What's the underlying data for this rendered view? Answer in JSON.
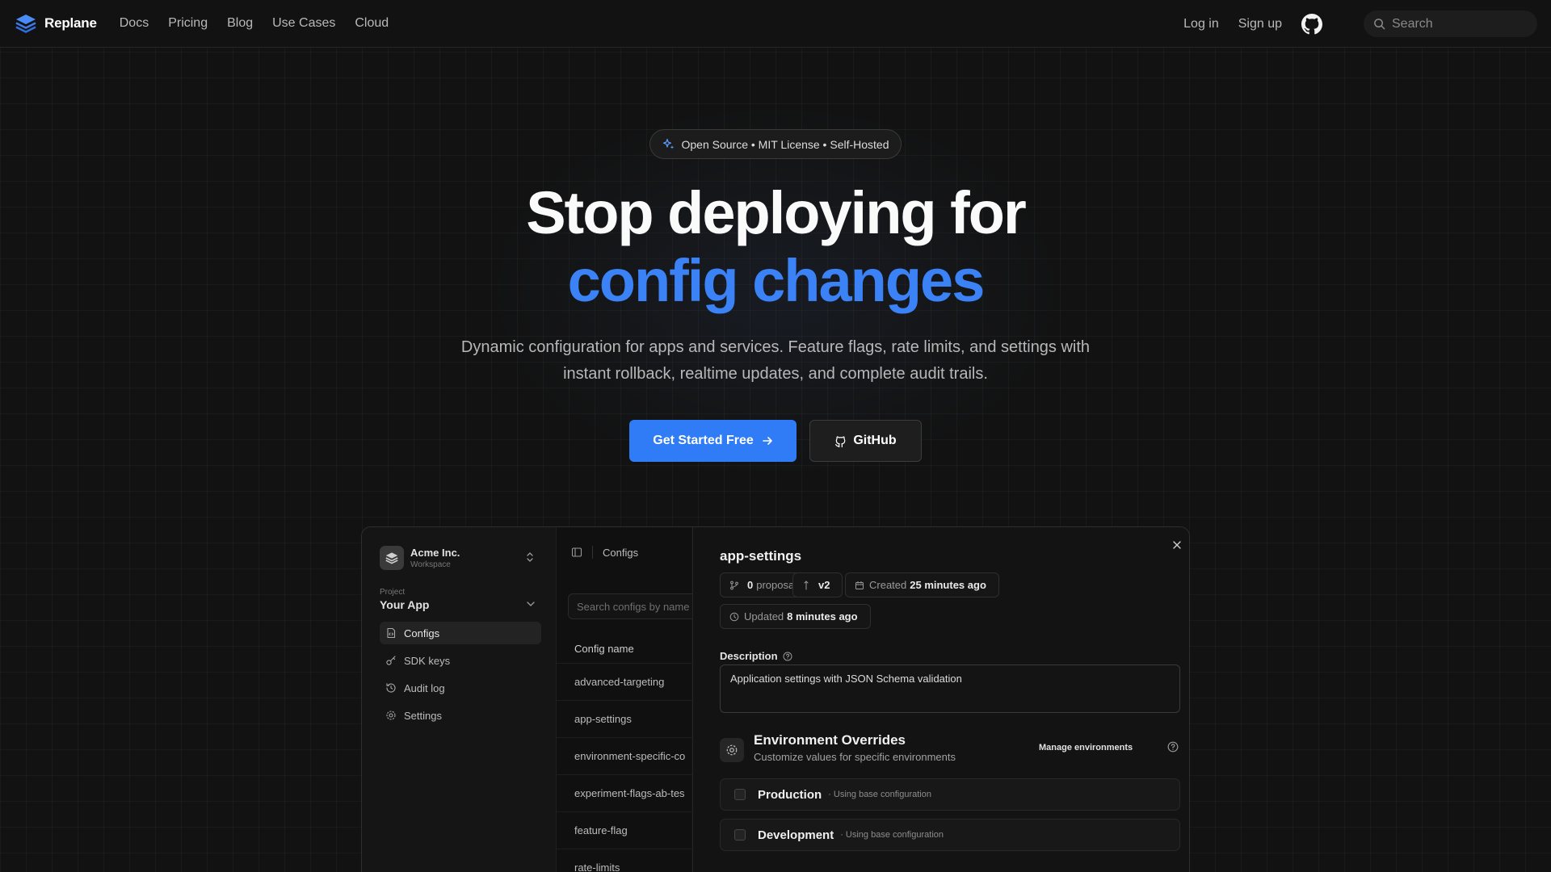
{
  "nav": {
    "brand": "Replane",
    "links": [
      "Docs",
      "Pricing",
      "Blog",
      "Use Cases",
      "Cloud"
    ],
    "login": "Log in",
    "signup": "Sign up",
    "search_placeholder": "Search"
  },
  "hero": {
    "badge": "Open Source • MIT License • Self-Hosted",
    "title_line1": "Stop deploying for",
    "title_line2": "config changes",
    "subtitle": "Dynamic configuration for apps and services. Feature flags, rate limits, and settings with instant rollback, realtime updates, and complete audit trails.",
    "cta_primary": "Get Started Free",
    "cta_secondary": "GitHub"
  },
  "preview": {
    "workspace_name": "Acme Inc.",
    "workspace_label": "Workspace",
    "project_label": "Project",
    "project_name": "Your App",
    "sidebar_items": [
      "Configs",
      "SDK keys",
      "Audit log",
      "Settings"
    ],
    "list_title": "Configs",
    "list_search_placeholder": "Search configs by name",
    "list_header": "Config name",
    "configs": [
      "advanced-targeting",
      "app-settings",
      "environment-specific-co",
      "experiment-flags-ab-tes",
      "feature-flag",
      "rate-limits"
    ],
    "detail": {
      "title": "app-settings",
      "proposals_count": "0",
      "proposals_label": "proposals",
      "version": "v2",
      "created_label": "Created",
      "created_value": "25 minutes ago",
      "updated_label": "Updated",
      "updated_value": "8 minutes ago",
      "description_label": "Description",
      "description_value": "Application settings with JSON Schema validation",
      "env_title": "Environment Overrides",
      "env_subtitle": "Customize values for specific environments",
      "manage_label": "Manage environments",
      "environments": [
        {
          "name": "Production",
          "note": "· Using base configuration"
        },
        {
          "name": "Development",
          "note": "· Using base configuration"
        }
      ]
    }
  },
  "colors": {
    "accent": "#3b82f6",
    "button_primary": "#2f7cf6",
    "background": "#121212"
  }
}
